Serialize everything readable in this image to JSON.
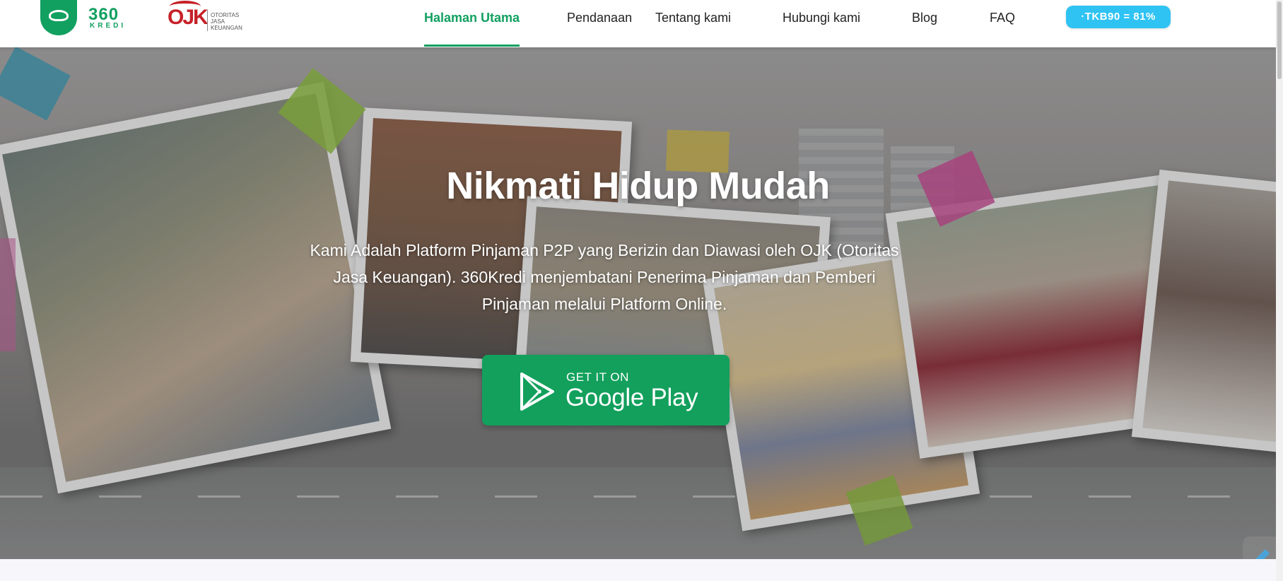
{
  "brand": {
    "logo_number": "360",
    "logo_subtitle": "KREDI",
    "ojk_letters": "OJK",
    "ojk_text": "OTORITAS\nJASA\nKEUANGAN"
  },
  "nav": {
    "items": [
      {
        "label": "Halaman Utama",
        "active": true
      },
      {
        "label": "Pendanaan"
      },
      {
        "label": "Tentang kami"
      },
      {
        "label": "Hubungi kami"
      },
      {
        "label": "Blog"
      },
      {
        "label": "FAQ"
      }
    ],
    "tkb_badge": "·TKB90 = 81%"
  },
  "hero": {
    "title": "Nikmati Hidup Mudah",
    "description": "Kami Adalah Platform Pinjaman P2P yang Berizin dan Diawasi oleh OJK (Otoritas Jasa Keuangan). 360Kredi menjembatani Penerima Pinjaman dan Pemberi Pinjaman melalui Platform Online.",
    "store_button": {
      "small_text": "GET IT ON",
      "big_text": "Google Play"
    }
  },
  "icons": {
    "play_store": "google-play-icon",
    "side_widget": "floating-helper-icon"
  },
  "colors": {
    "brand_green": "#12a060",
    "ojk_red": "#c62128",
    "tkb_blue": "#2fc3f3",
    "play_button": "#12a05c"
  }
}
